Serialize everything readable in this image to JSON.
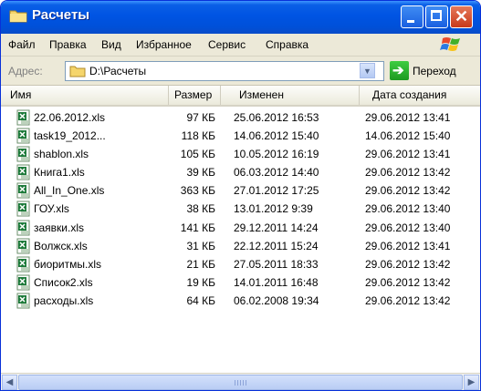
{
  "window": {
    "title": "Расчеты"
  },
  "menu": {
    "items": [
      "Файл",
      "Правка",
      "Вид",
      "Избранное",
      "Сервис",
      "Справка"
    ]
  },
  "address": {
    "label": "Адрес:",
    "value": "D:\\Расчеты",
    "go_label": "Переход"
  },
  "columns": {
    "name": "Имя",
    "size": "Размер",
    "modified": "Изменен",
    "created": "Дата создания"
  },
  "files": [
    {
      "name": "22.06.2012.xls",
      "size": "97 КБ",
      "modified": "25.06.2012 16:53",
      "created": "29.06.2012 13:41"
    },
    {
      "name": "task19_2012...",
      "size": "118 КБ",
      "modified": "14.06.2012 15:40",
      "created": "14.06.2012 15:40"
    },
    {
      "name": "shablon.xls",
      "size": "105 КБ",
      "modified": "10.05.2012 16:19",
      "created": "29.06.2012 13:41"
    },
    {
      "name": "Книга1.xls",
      "size": "39 КБ",
      "modified": "06.03.2012 14:40",
      "created": "29.06.2012 13:42"
    },
    {
      "name": "All_In_One.xls",
      "size": "363 КБ",
      "modified": "27.01.2012 17:25",
      "created": "29.06.2012 13:42"
    },
    {
      "name": "ГОУ.xls",
      "size": "38 КБ",
      "modified": "13.01.2012 9:39",
      "created": "29.06.2012 13:40"
    },
    {
      "name": "заявки.xls",
      "size": "141 КБ",
      "modified": "29.12.2011 14:24",
      "created": "29.06.2012 13:40"
    },
    {
      "name": "Волжск.xls",
      "size": "31 КБ",
      "modified": "22.12.2011 15:24",
      "created": "29.06.2012 13:41"
    },
    {
      "name": "биоритмы.xls",
      "size": "21 КБ",
      "modified": "27.05.2011 18:33",
      "created": "29.06.2012 13:42"
    },
    {
      "name": "Список2.xls",
      "size": "19 КБ",
      "modified": "14.01.2011 16:48",
      "created": "29.06.2012 13:42"
    },
    {
      "name": "расходы.xls",
      "size": "64 КБ",
      "modified": "06.02.2008 19:34",
      "created": "29.06.2012 13:42"
    }
  ],
  "icons": {
    "title": "folder-icon",
    "window_logo": "windows-logo-icon",
    "address": "folder-icon",
    "address_dropdown": "chevron-down-icon",
    "go": "arrow-right-icon",
    "file": "excel-file-icon",
    "scroll_left": "chevron-left-icon",
    "scroll_right": "chevron-right-icon"
  },
  "colors": {
    "titlebar": "#0054e3",
    "close_button": "#c8391b",
    "go_button": "#1e9a22",
    "excel_icon": "#1d7a3a"
  }
}
